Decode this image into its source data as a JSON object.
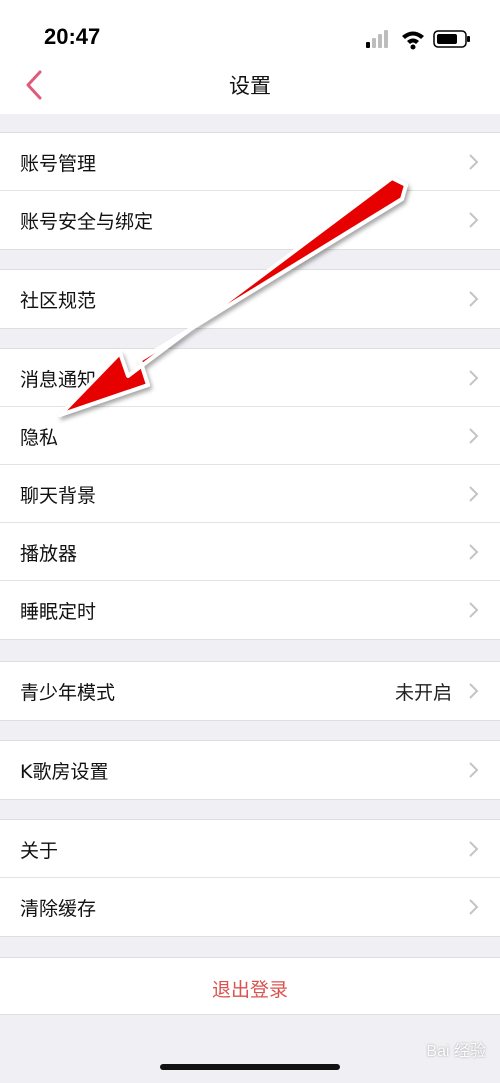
{
  "status_bar": {
    "time": "20:47"
  },
  "nav": {
    "title": "设置"
  },
  "groups": [
    {
      "items": [
        {
          "label": "账号管理"
        },
        {
          "label": "账号安全与绑定"
        }
      ]
    },
    {
      "items": [
        {
          "label": "社区规范"
        }
      ]
    },
    {
      "items": [
        {
          "label": "消息通知"
        },
        {
          "label": "隐私"
        },
        {
          "label": "聊天背景"
        },
        {
          "label": "播放器"
        },
        {
          "label": "睡眠定时"
        }
      ]
    },
    {
      "items": [
        {
          "label": "青少年模式",
          "value": "未开启"
        }
      ]
    },
    {
      "items": [
        {
          "label": "K歌房设置"
        }
      ]
    },
    {
      "items": [
        {
          "label": "关于"
        },
        {
          "label": "清除缓存"
        }
      ]
    }
  ],
  "logout": {
    "label": "退出登录"
  },
  "colors": {
    "accent_back": "#e05a7a",
    "logout": "#d9534f",
    "arrow": "#e60000"
  },
  "watermark": {
    "text": "Bai 经验"
  }
}
